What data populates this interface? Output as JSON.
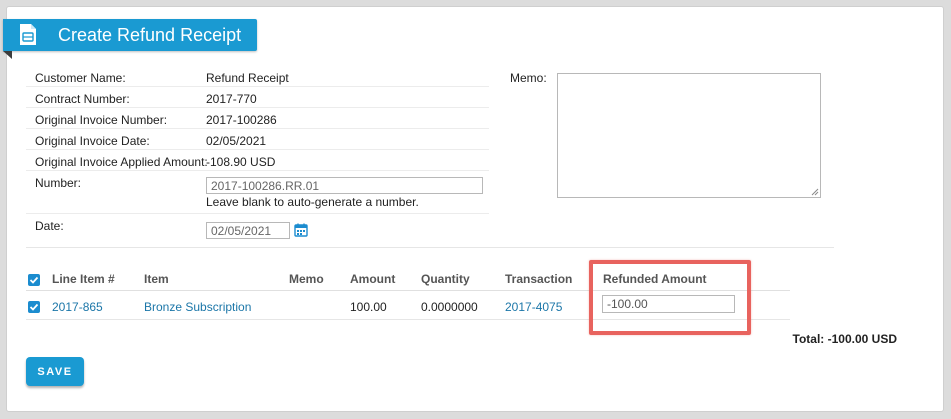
{
  "title": "Create Refund Receipt",
  "fields": {
    "customer_name_label": "Customer Name:",
    "customer_name_value": "Refund Receipt",
    "contract_number_label": "Contract Number:",
    "contract_number_value": "2017-770",
    "original_invoice_number_label": "Original Invoice Number:",
    "original_invoice_number_value": "2017-100286",
    "original_invoice_date_label": "Original Invoice Date:",
    "original_invoice_date_value": "02/05/2021",
    "applied_amount_label": "Original Invoice Applied Amount:",
    "applied_amount_value": "-108.90 USD",
    "number_label": "Number:",
    "number_value": "2017-100286.RR.01",
    "number_help": "Leave blank to auto-generate a number.",
    "date_label": "Date:",
    "date_value": "02/05/2021"
  },
  "memo": {
    "label": "Memo:",
    "value": ""
  },
  "line_items": {
    "headers": {
      "line_item": "Line Item #",
      "item": "Item",
      "memo": "Memo",
      "amount": "Amount",
      "quantity": "Quantity",
      "transaction": "Transaction",
      "refunded_amount": "Refunded Amount"
    },
    "rows": [
      {
        "checked": true,
        "line_item": "2017-865",
        "item": "Bronze Subscription",
        "memo": "",
        "amount": "100.00",
        "quantity": "0.0000000",
        "transaction": "2017-4075",
        "refunded_amount": "-100.00"
      }
    ]
  },
  "total": "Total: -100.00 USD",
  "save_label": "SAVE",
  "colors": {
    "accent": "#1a9ad2",
    "link": "#1b76a8",
    "highlight": "#e8635e"
  },
  "icons": {
    "title": "receipt-icon",
    "date": "calendar-icon",
    "check": "checkmark-icon"
  }
}
